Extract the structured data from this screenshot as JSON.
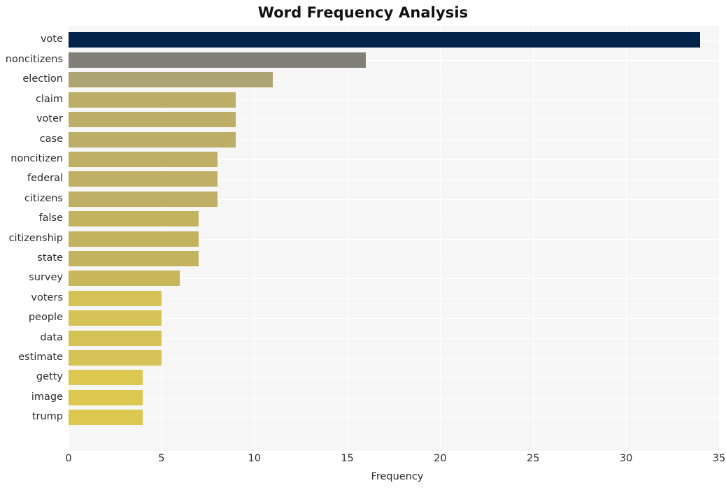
{
  "chart_data": {
    "type": "bar",
    "orientation": "horizontal",
    "title": "Word Frequency Analysis",
    "xlabel": "Frequency",
    "ylabel": "",
    "xlim": [
      0,
      35
    ],
    "xticks": [
      0,
      5,
      10,
      15,
      20,
      25,
      30,
      35
    ],
    "grid": true,
    "legend": null,
    "categories": [
      "vote",
      "noncitizens",
      "election",
      "claim",
      "voter",
      "case",
      "noncitizen",
      "federal",
      "citizens",
      "false",
      "citizenship",
      "state",
      "survey",
      "voters",
      "people",
      "data",
      "estimate",
      "getty",
      "image",
      "trump"
    ],
    "values": [
      34,
      16,
      11,
      9,
      9,
      9,
      8,
      8,
      8,
      7,
      7,
      7,
      6,
      5,
      5,
      5,
      5,
      4,
      4,
      4
    ],
    "bar_colors": [
      "#03234b",
      "#827f79",
      "#ada473",
      "#bcad67",
      "#bcad67",
      "#bcad67",
      "#bfaf64",
      "#bfaf64",
      "#bfaf64",
      "#c4b35e",
      "#c4b35e",
      "#c4b35e",
      "#c8b75a",
      "#d4c256",
      "#d4c256",
      "#d4c256",
      "#d4c256",
      "#dcc851",
      "#dcc851",
      "#dcc851"
    ]
  },
  "style": {
    "plot_background": "#f6f6f6",
    "figure_background": "#ffffff",
    "gridline_color": "#ffffff",
    "tick_text_color": "#2b2b2b",
    "title_color": "#111111"
  }
}
